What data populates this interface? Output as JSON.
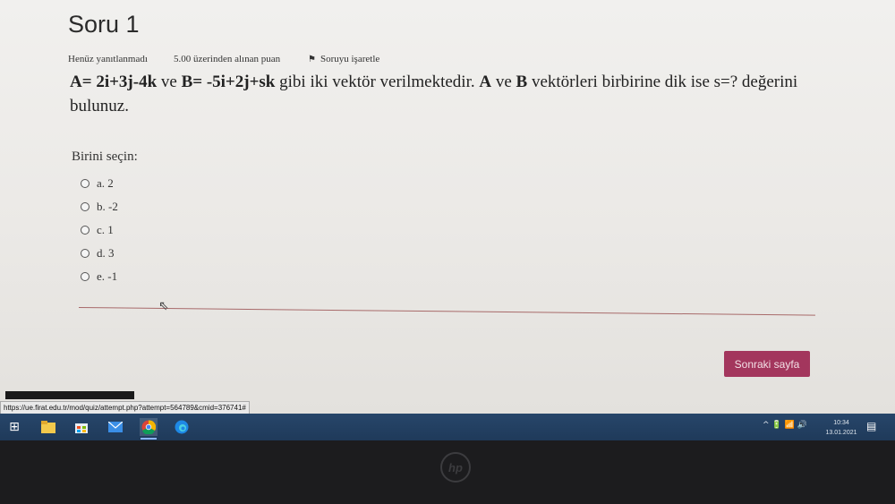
{
  "quiz": {
    "title": "Soru 1",
    "status": "Henüz yanıtlanmadı",
    "points": "5.00 üzerinden alınan puan",
    "flag_label": "Soruyu işaretle",
    "question": {
      "a_label": "A=",
      "a_vec": " 2i+3j-4k",
      "middle1": " ve ",
      "b_label": "B=",
      "b_vec": " -5i+2j+sk",
      "middle2": " gibi iki vektör verilmektedir. ",
      "a2": "A",
      "middle3": " ve ",
      "b2": "B",
      "end": " vektörleri birbirine dik ise s=? değerini bulunuz."
    },
    "choose_label": "Birini seçin:",
    "options": [
      "a. 2",
      "b. -2",
      "c. 1",
      "d. 3",
      "e. -1"
    ],
    "next_button": "Sonraki sayfa"
  },
  "browser": {
    "status_url": "https://ue.firat.edu.tr/mod/quiz/attempt.php?attempt=564789&cmid=376741#"
  },
  "taskbar": {
    "icons": [
      "windows-start-icon",
      "file-explorer-icon",
      "store-icon",
      "mail-icon",
      "chrome-icon",
      "edge-icon"
    ],
    "tray_text": "^ 🔋 📶 🔊",
    "time": "10:34",
    "date": "13.01.2021"
  },
  "bezel": {
    "logo": "hp"
  },
  "colors": {
    "accent": "#a3365d",
    "taskbar": "#27466a"
  }
}
